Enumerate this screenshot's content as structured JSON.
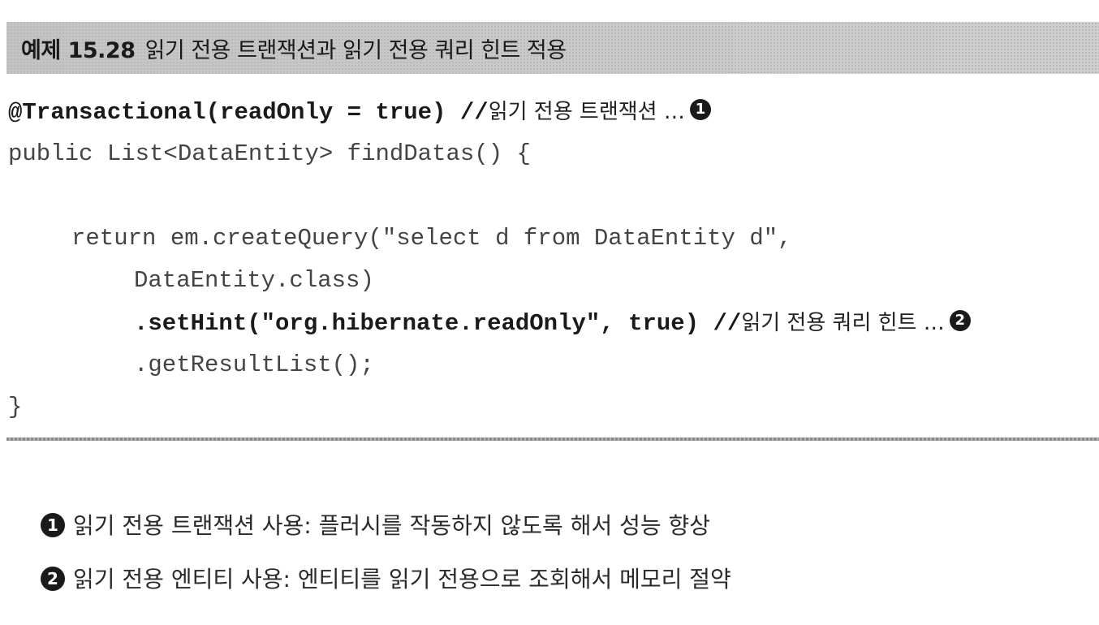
{
  "header": {
    "number": "예제 15.28",
    "title": "읽기 전용 트랜잭션과 읽기 전용 쿼리 힌트 적용"
  },
  "code": {
    "l1_code": "@Transactional(readOnly = true) //",
    "l1_comment": "읽기 전용 트랜잭션 …",
    "l1_marker": "1",
    "l2": "public List<DataEntity> findDatas() {",
    "l4": "return em.createQuery(\"select d from DataEntity d\",",
    "l5": "DataEntity.class)",
    "l6_code": ".setHint(\"org.hibernate.readOnly\", true) //",
    "l6_comment": "읽기 전용 쿼리 힌트 …",
    "l6_marker": "2",
    "l7": ".getResultList();",
    "l8": "}"
  },
  "notes": [
    {
      "marker": "1",
      "text": "읽기 전용 트랜잭션 사용: 플러시를 작동하지 않도록 해서 성능 향상"
    },
    {
      "marker": "2",
      "text": "읽기 전용 엔티티 사용: 엔티티를 읽기 전용으로 조회해서 메모리 절약"
    }
  ]
}
